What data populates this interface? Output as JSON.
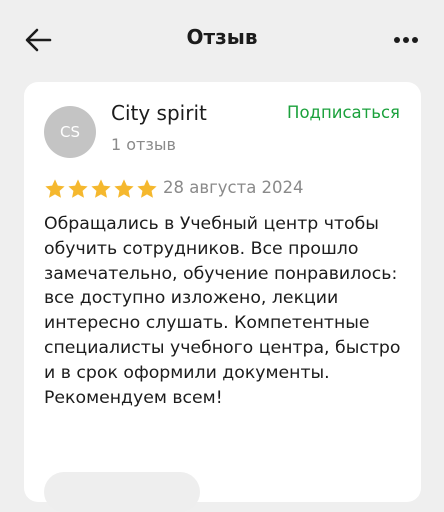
{
  "header": {
    "title": "Отзыв",
    "back_icon": "arrow-left-icon",
    "more_icon": "more-dots-icon"
  },
  "review": {
    "author": {
      "initials": "CS",
      "name": "City spirit",
      "reviews_count": "1 отзыв"
    },
    "subscribe_label": "Подписаться",
    "rating": 5,
    "rating_max": 5,
    "date": "28 августа 2024",
    "text": "Обращались в Учебный центр чтобы обучить сотрудников. Все прошло замечательно, обучение понравилось: все доступно изложено, лекции интересно слушать. Компетентные специалисты учебного центра, быстро и в срок оформили документы. Рекомендуем всем!"
  },
  "colors": {
    "background": "#efefef",
    "card": "#ffffff",
    "accent_green": "#1ba13c",
    "star": "#f5b82e",
    "secondary_text": "#8a8a8a",
    "avatar": "#c4c4c4"
  }
}
